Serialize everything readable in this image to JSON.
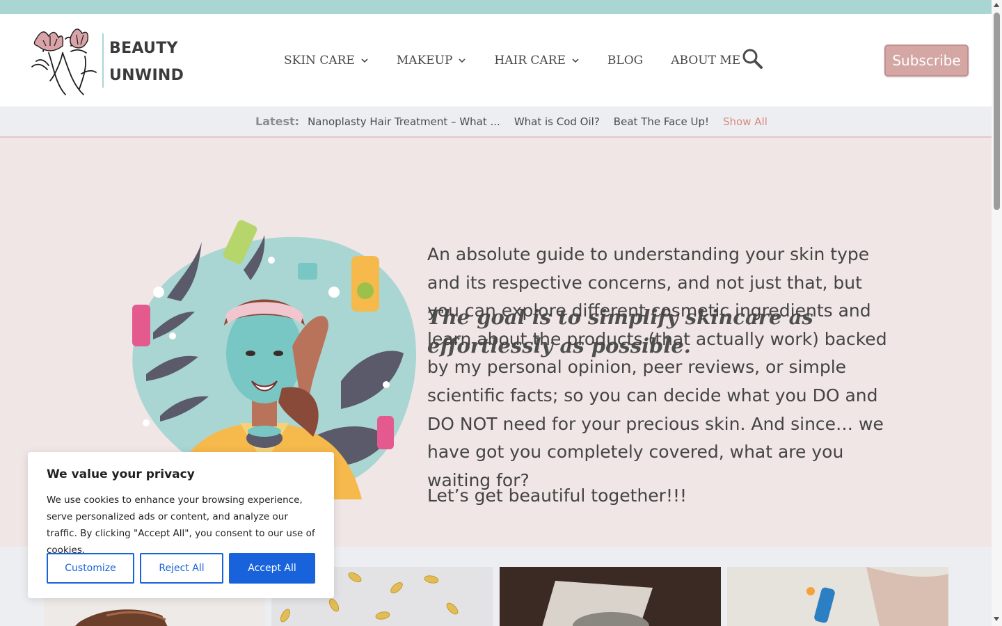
{
  "brand": {
    "line1": "BEAUTY",
    "line2": "UNWIND",
    "topbar_color": "#a9d6d3",
    "accent_color": "#d4a7a5"
  },
  "nav": {
    "items": [
      {
        "label": "SKIN CARE",
        "has_dropdown": true
      },
      {
        "label": "MAKEUP",
        "has_dropdown": true
      },
      {
        "label": "HAIR CARE",
        "has_dropdown": true
      },
      {
        "label": "BLOG",
        "has_dropdown": false
      },
      {
        "label": "ABOUT ME",
        "has_dropdown": false
      }
    ],
    "search_icon": "search-icon",
    "subscribe_label": "Subscribe"
  },
  "latest": {
    "label": "Latest:",
    "links": [
      "Nanoplasty Hair Treatment – What ...",
      "What is Cod Oil?",
      "Beat The Face Up!"
    ],
    "show_all": "Show All"
  },
  "hero": {
    "title": "The goal is to simplify skincare as effortlessly as possible.",
    "body": "An absolute guide to understanding your skin type and its respective concerns, and not just that, but you can explore different cosmetic ingredients and learn about the products (that actually work) backed by my personal opinion, peer reviews, or simple scientific facts; so you can decide what you DO and DO NOT need for your precious skin. And since… we have got you completely covered, what are you waiting for?",
    "cta": "Let’s get beautiful together!!!"
  },
  "cookie": {
    "title": "We value your privacy",
    "text": "We use cookies to enhance your browsing experience, serve personalized ads or content, and analyze our traffic. By clicking \"Accept All\", you consent to our use of cookies.",
    "customize": "Customize",
    "reject": "Reject All",
    "accept": "Accept All",
    "button_color": "#1863dc"
  }
}
